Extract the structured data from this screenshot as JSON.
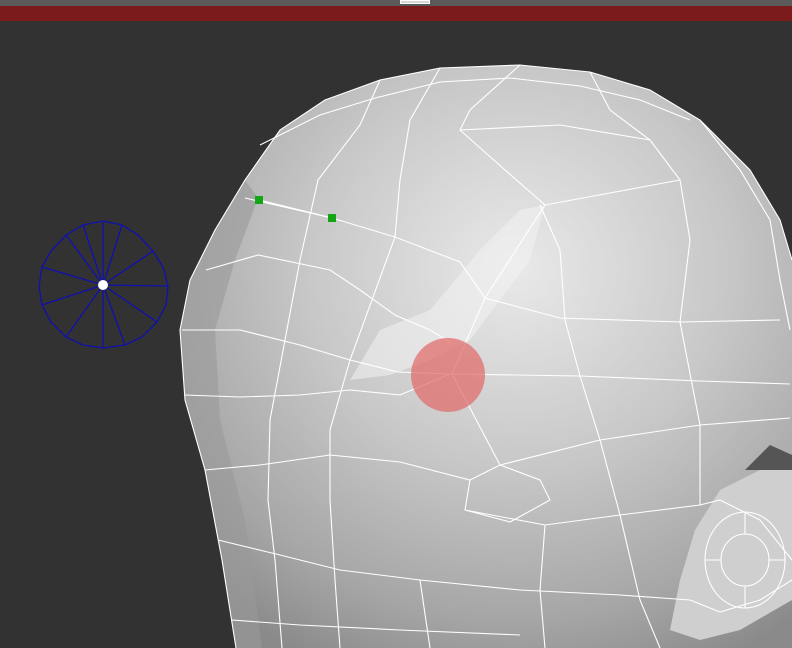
{
  "colors": {
    "background": "#323232",
    "header_bar": "#7b1b1b",
    "wireframe": "#ffffff",
    "brush_cursor": "#e06a6a",
    "selected_vertex": "#13a513",
    "gizmo": "#1010b0"
  },
  "icons": {
    "gizmo": "circle-gizmo-icon",
    "brush": "brush-cursor-icon",
    "vertex": "vertex-handle-icon"
  }
}
